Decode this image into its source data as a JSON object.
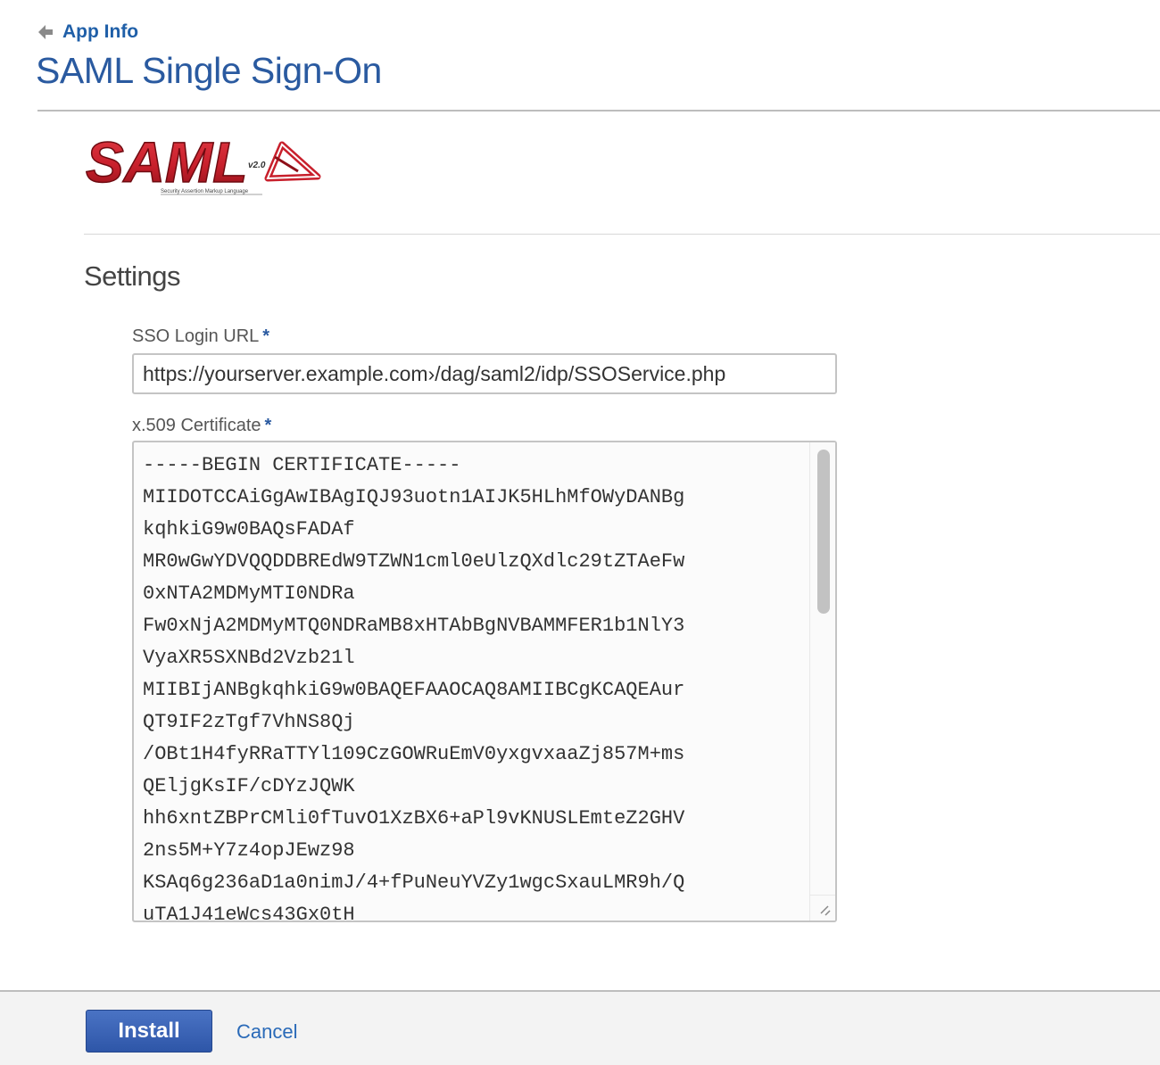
{
  "nav": {
    "back_label": "App Info",
    "back_icon": "arrow-left-icon"
  },
  "page": {
    "title": "SAML Single Sign-On"
  },
  "logo": {
    "text": "SAML",
    "version": "v2.0",
    "tagline": "Security Assertion Markup Language",
    "colors": {
      "primary": "#c8202c",
      "outline": "#7a0d14"
    }
  },
  "settings": {
    "title": "Settings",
    "sso_url": {
      "label": "SSO Login URL",
      "required_mark": "*",
      "value": "https://yourserver.example.com›/dag/saml2/idp/SSOService.php"
    },
    "certificate": {
      "label": "x.509 Certificate",
      "required_mark": "*",
      "value": "-----BEGIN CERTIFICATE-----\nMIIDOTCCAiGgAwIBAgIQJ93uotn1AIJK5HLhMfOWyDANBg\nkqhkiG9w0BAQsFADAf\nMR0wGwYDVQQDDBREdW9TZWN1cml0eUlzQXdlc29tZTAeFw\n0xNTA2MDMyMTI0NDRa\nFw0xNjA2MDMyMTQ0NDRaMB8xHTAbBgNVBAMMFER1b1NlY3\nVyaXR5SXNBd2Vzb21l\nMIIBIjANBgkqhkiG9w0BAQEFAAOCAQ8AMIIBCgKCAQEAur\nQT9IF2zTgf7VhNS8Qj\n/OBt1H4fyRRaTTYl109CzGOWRuEmV0yxgvxaaZj857M+ms\nQEljgKsIF/cDYzJQWK\nhh6xntZBPrCMli0fTuvO1XzBX6+aPl9vKNUSLEmteZ2GHV\n2ns5M+Y7z4opJEwz98\nKSAq6g236aD1a0nimJ/4+fPuNeuYVZy1wgcSxauLMR9h/Q\nuTA1J41eWcs43Gx0tH"
    }
  },
  "footer": {
    "install_label": "Install",
    "cancel_label": "Cancel"
  },
  "colors": {
    "accent": "#2a5aa0",
    "link": "#1f5fa8",
    "button": "#3a64b8"
  }
}
